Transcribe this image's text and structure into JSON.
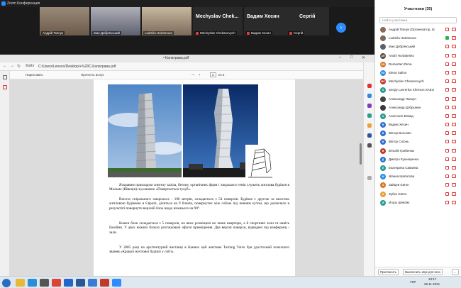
{
  "zoom": {
    "window_title": "Zoom Конференция",
    "tiles": [
      {
        "name": "Андрій Ткачук",
        "type": "video",
        "color": "#6b5a4a"
      },
      {
        "name": "Іван Добрянський",
        "type": "video",
        "color": "#5d6070"
      },
      {
        "name": "Ludmila Harlamova",
        "type": "video",
        "color": "#7a6a58"
      },
      {
        "name": "Mechyslav Chekanovych",
        "label": "Mechyslav Chek...",
        "type": "name"
      },
      {
        "name": "Вадим Хесин",
        "label": "Вадим Хесин",
        "type": "name"
      },
      {
        "name": "Сергій",
        "label": "Сергій",
        "type": "name"
      }
    ],
    "next_icon": "chevron-right-icon"
  },
  "browser": {
    "tab_title": "• Калатрава.pdf",
    "address": "C:/Users/Lenovo/Desktop/+%20C.Калатрава.pdf",
    "address_prefix": "Файл",
    "pdf_toolbar": {
      "highlight": "Нарисовать",
      "read_aloud": "Прочесть вслух",
      "page_current": "2",
      "page_total": "из 5",
      "zoom_minus": "—",
      "zoom_plus": "+"
    }
  },
  "pdf": {
    "paragraphs": [
      "Яскравим прикладом синтезу заліза, бетону, органічних форм і людського генія служить житлова будівля в Мальме (Швеція) під назвою «Повертається тулуб».",
      "Висота спірального хмарочоса - 190 метрів, складається з 54 поверхів. Будівля є другою за висотою житловою будівлею в Європі, ділиться на 9 блоків, повернутих між собою під певним кутом, що дозволяло в результаті повернути верхній блок щодо нижнього на 90°.",
      "Кожен блок складається з 5 поверхів, на яких розміщені не лише квартири, а й спортивні зали та навіть басейни. У двох нижніх блоках розташовані офісні приміщення. Два верхні поверхи, відведені під конференц - зали.",
      "У 2005 році на архітектурній виставці в Каннах цей житлове Turning Torso був удостоєний почесного звання «Кращої житлової будівлі у світі»."
    ]
  },
  "participants": {
    "header": "Участники (35)",
    "search_placeholder": "Найти участника",
    "list": [
      {
        "name": "Андрій Ткачук (Организатор, я)",
        "initials": "",
        "color": "#8a6b5a",
        "photo": true,
        "mic": "muted"
      },
      {
        "name": "Ludmila Harlamova",
        "initials": "",
        "color": "#7a6a58",
        "photo": true,
        "mic": "on"
      },
      {
        "name": "Іван Добрянський",
        "initials": "",
        "color": "#5d6070",
        "photo": true,
        "mic": "muted"
      },
      {
        "name": "Andrii Horbatenko",
        "initials": "AH",
        "color": "#5a4a3a",
        "mic": "muted"
      },
      {
        "name": "Dementen Dima",
        "initials": "DD",
        "color": "#d4792a",
        "mic": "muted"
      },
      {
        "name": "Elena Salino",
        "initials": "ES",
        "color": "#2f8de4",
        "mic": "muted"
      },
      {
        "name": "Mechyslav Chekanovych",
        "initials": "MC",
        "color": "#c0392b",
        "mic": "muted"
      },
      {
        "name": "Sergiy Lavrenko Kherson SAEU",
        "initials": "S",
        "color": "#2a9d8f",
        "mic": "muted"
      },
      {
        "name": "Александр Панкул",
        "initials": "",
        "color": "#444",
        "photo": true,
        "mic": "muted"
      },
      {
        "name": "Александр Добрынин",
        "initials": "",
        "color": "#3a3a3a",
        "photo": true,
        "mic": "muted"
      },
      {
        "name": "Анастасія Влвад",
        "initials": "А",
        "color": "#2a9d8f",
        "mic": "muted"
      },
      {
        "name": "Вадим Хесин",
        "initials": "В",
        "color": "#2f6fd4",
        "mic": "muted"
      },
      {
        "name": "Віктор Волозин",
        "initials": "В",
        "color": "#2f6fd4",
        "mic": "muted"
      },
      {
        "name": "Віктор Сліонь",
        "initials": "В",
        "color": "#2f6fd4",
        "mic": "muted"
      },
      {
        "name": "Віталій Грибенюк",
        "initials": "В",
        "color": "#c0392b",
        "mic": "muted"
      },
      {
        "name": "Дмитро Кушнаренко",
        "initials": "Д",
        "color": "#2f6fd4",
        "mic": "muted"
      },
      {
        "name": "Екатерина Саваева",
        "initials": "Е",
        "color": "#2a9d8f",
        "mic": "muted"
      },
      {
        "name": "Жанна Шапатова",
        "initials": "Ж",
        "color": "#2f8de4",
        "mic": "muted"
      },
      {
        "name": "Зайцев Євген",
        "initials": "З",
        "color": "#d4792a",
        "mic": "muted"
      },
      {
        "name": "Зубко Євген",
        "initials": "З",
        "color": "#e6a23c",
        "mic": "muted"
      },
      {
        "name": "Игорь Шевляк",
        "initials": "И",
        "color": "#2a9d8f",
        "mic": "muted"
      }
    ],
    "invite_label": "Пригласить",
    "mute_all_label": "Выключить звук для всех",
    "more_label": "..."
  },
  "taskbar": {
    "time": "13:17",
    "date": "25.11.2021",
    "lang": "УКР",
    "apps": [
      {
        "name": "explorer-icon",
        "color": "#e7b93a"
      },
      {
        "name": "edge-icon",
        "color": "#2b8fd8"
      },
      {
        "name": "store-icon",
        "color": "#555"
      },
      {
        "name": "chrome-icon",
        "color": "#db4437"
      },
      {
        "name": "mail-icon",
        "color": "#2266cc"
      },
      {
        "name": "word-icon",
        "color": "#2b579a"
      },
      {
        "name": "photos-icon",
        "color": "#3a7bd5"
      },
      {
        "name": "pdf-icon",
        "color": "#c0392b"
      },
      {
        "name": "zoom-icon",
        "color": "#2d8cff"
      }
    ]
  }
}
